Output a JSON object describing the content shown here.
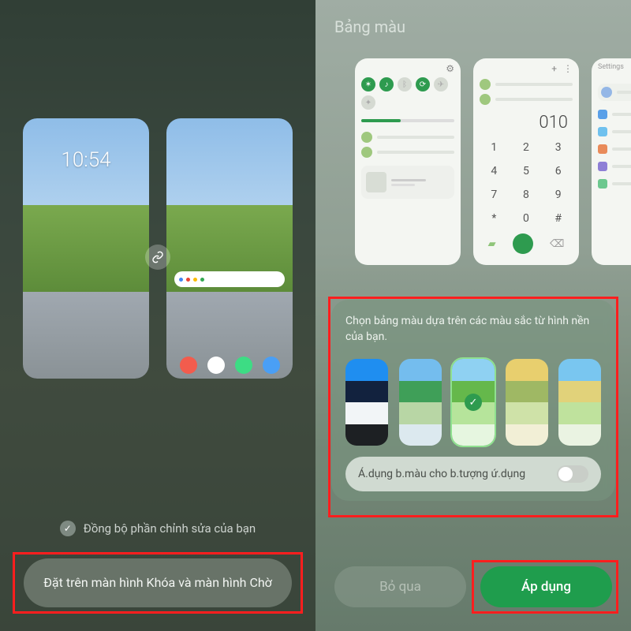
{
  "left": {
    "lock_time": "10:54",
    "sync_label": "Đồng bộ phần chỉnh sửa của bạn",
    "set_button": "Đặt trên màn hình Khóa và màn hình Chờ"
  },
  "right": {
    "title": "Bảng màu",
    "mini": {
      "quick_label": "",
      "dial_number": "010",
      "dial_keys": [
        "1",
        "2",
        "3",
        "4",
        "5",
        "6",
        "7",
        "8",
        "9",
        "*",
        "0",
        "#"
      ],
      "settings_label": "Settings"
    },
    "sheet": {
      "description": "Chọn bảng màu dựa trên các màu sắc từ hình nền của bạn.",
      "palettes": [
        {
          "colors": [
            "#1f8ef0",
            "#12223e",
            "#f2f5f7",
            "#1d2023"
          ],
          "selected": false
        },
        {
          "colors": [
            "#74bdee",
            "#3f9f58",
            "#b8d6a5",
            "#dce9ef"
          ],
          "selected": false
        },
        {
          "colors": [
            "#8fd1f2",
            "#65b84b",
            "#b6e49b",
            "#e6f6e0"
          ],
          "selected": true
        },
        {
          "colors": [
            "#e8cf6e",
            "#9fb864",
            "#cfe2a8",
            "#f2efd6"
          ],
          "selected": false
        },
        {
          "colors": [
            "#79c6f0",
            "#e1d27a",
            "#bfe29d",
            "#eaf3e2"
          ],
          "selected": false
        }
      ],
      "apply_icons_label": "Á.dụng b.màu cho b.tượng ứ.dụng",
      "apply_icons_on": false
    },
    "buttons": {
      "skip": "Bỏ qua",
      "apply": "Áp dụng"
    }
  }
}
